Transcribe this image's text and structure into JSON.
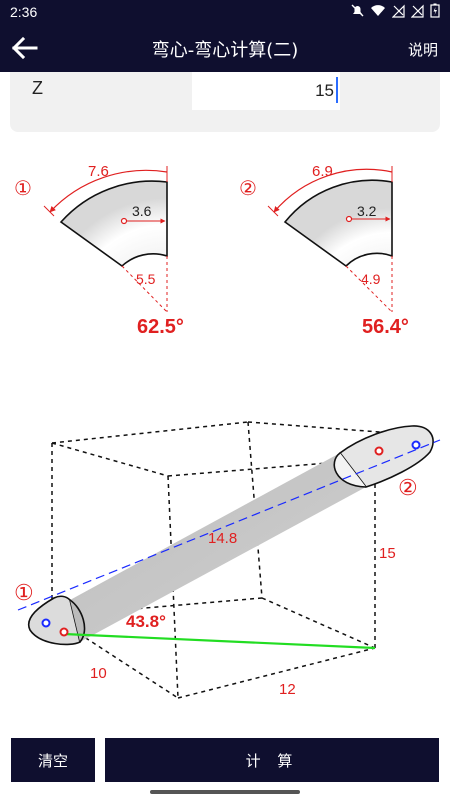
{
  "status": {
    "time": "2:36"
  },
  "header": {
    "title": "弯心-弯心计算(二)",
    "help_label": "说明"
  },
  "input": {
    "label": "Z",
    "value": "15"
  },
  "bend1": {
    "marker": "①",
    "outer": "7.6",
    "center": "3.6",
    "inner": "5.5",
    "angle": "62.5°"
  },
  "bend2": {
    "marker": "②",
    "outer": "6.9",
    "center": "3.2",
    "inner": "4.9",
    "angle": "56.4°"
  },
  "pipe": {
    "marker1": "①",
    "marker2": "②",
    "length": "14.8",
    "angle": "43.8°",
    "dim_x": "10",
    "dim_y": "12",
    "dim_z": "15"
  },
  "buttons": {
    "clear": "清空",
    "calculate": "计 算"
  },
  "colors": {
    "bar": "#0f0f2f",
    "red": "#e02020",
    "blue": "#1a2aff",
    "green": "#22dd22"
  }
}
